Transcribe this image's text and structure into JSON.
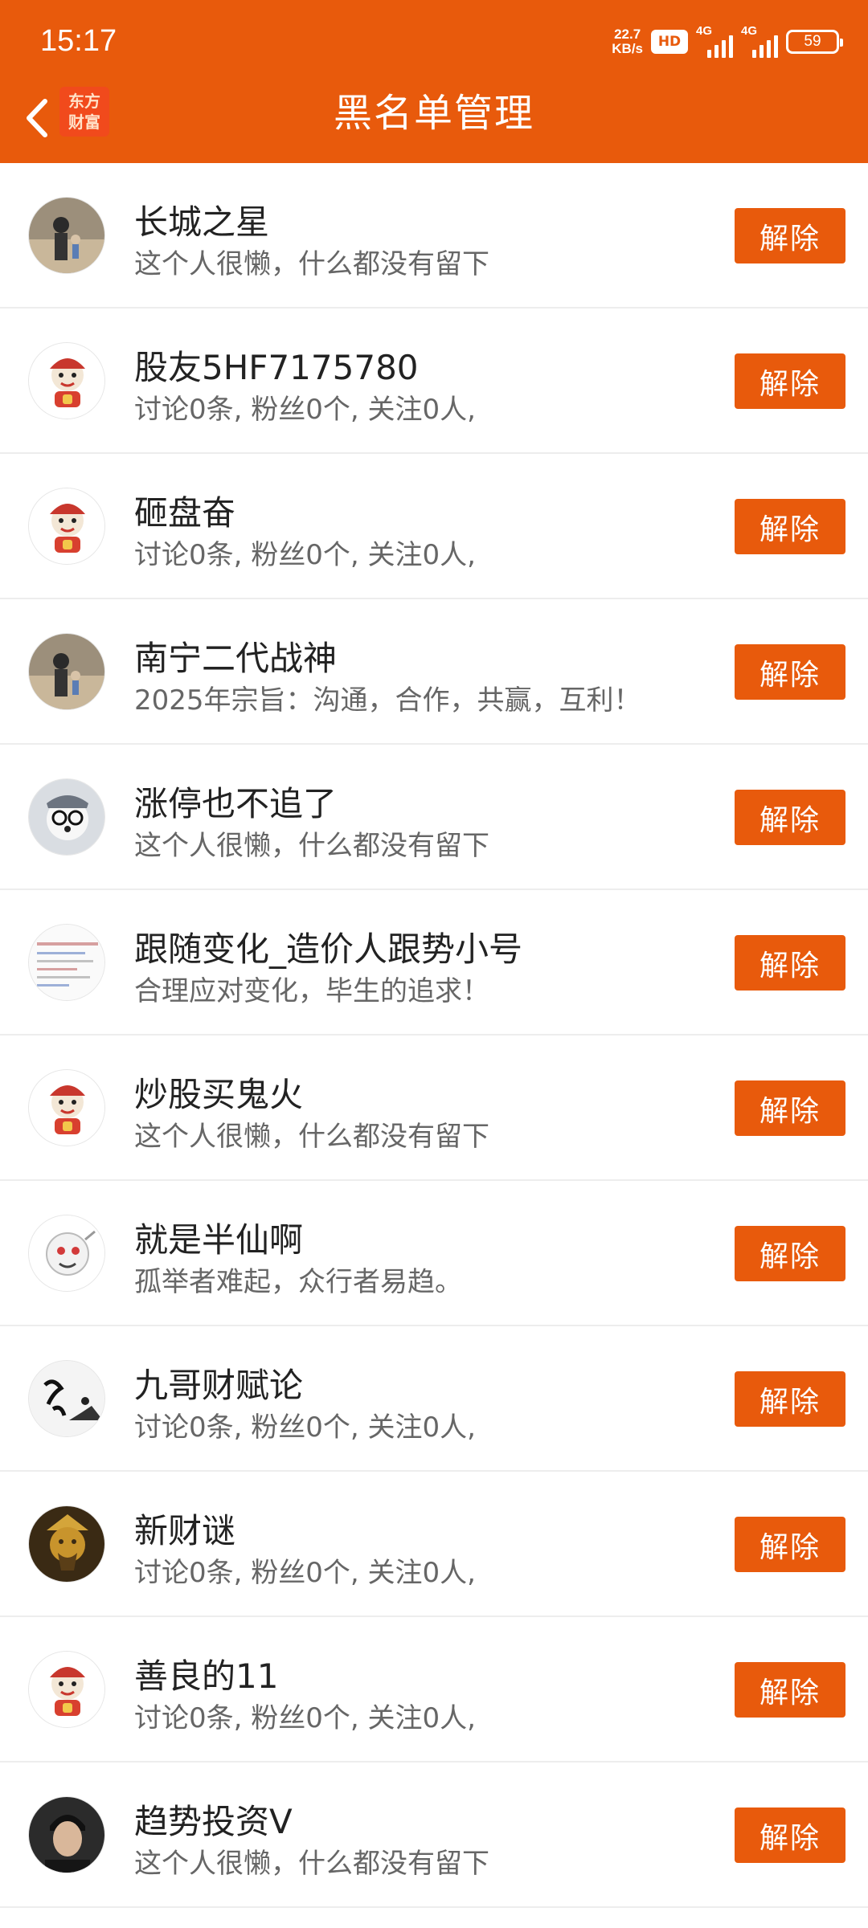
{
  "status_bar": {
    "time": "15:17",
    "net_speed_value": "22.7",
    "net_speed_unit": "KB/s",
    "hd_label": "HD",
    "network1": "4G",
    "network2": "4G",
    "battery": "59"
  },
  "nav": {
    "title": "黑名单管理",
    "logo_line1": "东方",
    "logo_line2": "财富"
  },
  "action_label": "解除",
  "items": [
    {
      "name": "长城之星",
      "desc": "这个人很懒，什么都没有留下",
      "avatar": "photo-avatar"
    },
    {
      "name": "股友5HF7175780",
      "desc": "讨论0条, 粉丝0个, 关注0人,",
      "avatar": "default-mascot-avatar"
    },
    {
      "name": "砸盘奋",
      "desc": "讨论0条, 粉丝0个, 关注0人,",
      "avatar": "default-mascot-avatar"
    },
    {
      "name": "南宁二代战神",
      "desc": "2025年宗旨：沟通，合作，共赢，互利！",
      "avatar": "photo-avatar"
    },
    {
      "name": "涨停也不追了",
      "desc": "这个人很懒，什么都没有留下",
      "avatar": "dog-avatar"
    },
    {
      "name": "跟随变化_造价人跟势小号",
      "desc": "合理应对变化，毕生的追求！",
      "avatar": "document-avatar"
    },
    {
      "name": "炒股买鬼火",
      "desc": "这个人很懒，什么都没有留下",
      "avatar": "default-mascot-avatar"
    },
    {
      "name": "就是半仙啊",
      "desc": "孤举者难起，众行者易趋。",
      "avatar": "cartoon-avatar"
    },
    {
      "name": "九哥财赋论",
      "desc": "讨论0条, 粉丝0个, 关注0人,",
      "avatar": "ink-calligraphy-avatar"
    },
    {
      "name": "新财谜",
      "desc": "讨论0条, 粉丝0个, 关注0人,",
      "avatar": "golden-statue-avatar"
    },
    {
      "name": "善良的11",
      "desc": "讨论0条, 粉丝0个, 关注0人,",
      "avatar": "default-mascot-avatar"
    },
    {
      "name": "趋势投资V",
      "desc": "这个人很懒，什么都没有留下",
      "avatar": "portrait-avatar"
    }
  ],
  "colors": {
    "primary": "#e85a0c",
    "divider": "#ededed",
    "name_text": "#222222",
    "desc_text": "#666666"
  }
}
